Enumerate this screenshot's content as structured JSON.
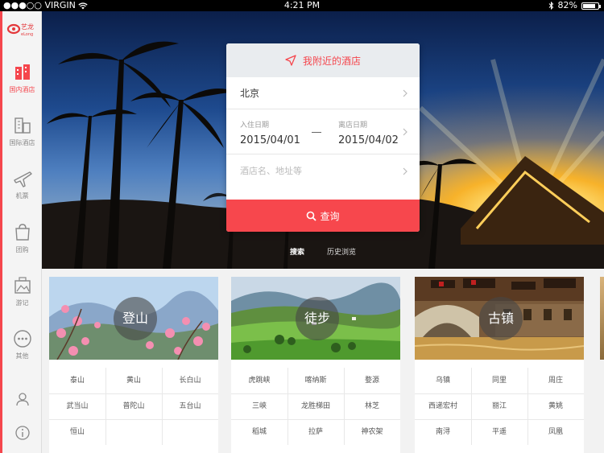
{
  "status_bar": {
    "carrier": "●●●○○ VIRGIN",
    "time": "4:21 PM",
    "battery": "82%",
    "battery_level": 0.82
  },
  "sidebar": {
    "logo_text": "艺龙",
    "logo_sub": "eLong",
    "items": [
      {
        "label": "国内酒店",
        "icon": "hotel-icon",
        "active": true
      },
      {
        "label": "国际酒店",
        "icon": "international-hotel-icon"
      },
      {
        "label": "机票",
        "icon": "airplane-icon"
      },
      {
        "label": "团购",
        "icon": "shopping-bag-icon"
      },
      {
        "label": "游记",
        "icon": "travel-notes-icon"
      },
      {
        "label": "其他",
        "icon": "more-icon"
      }
    ],
    "bottom_icons": [
      "user-icon",
      "info-icon"
    ]
  },
  "search": {
    "nearby_label": "我附近的酒店",
    "city": "北京",
    "checkin_label": "入住日期",
    "checkin_value": "2015/04/01",
    "checkout_label": "离店日期",
    "checkout_value": "2015/04/02",
    "keyword_placeholder": "酒店名、地址等",
    "search_button": "查询",
    "tabs": [
      "搜索",
      "历史浏览"
    ]
  },
  "categories": [
    {
      "title": "登山",
      "places": [
        "泰山",
        "黄山",
        "长白山",
        "武当山",
        "普陀山",
        "五台山",
        "恒山"
      ]
    },
    {
      "title": "徒步",
      "places": [
        "虎跳峡",
        "喀纳斯",
        "婺源",
        "三峡",
        "龙胜梯田",
        "林芝",
        "稻城",
        "拉萨",
        "神农架"
      ]
    },
    {
      "title": "古镇",
      "places": [
        "乌镇",
        "同里",
        "周庄",
        "西递宏村",
        "丽江",
        "黄姚",
        "南浔",
        "平遥",
        "凤凰"
      ]
    }
  ],
  "colors": {
    "accent": "#f5464d",
    "sidebar_bg": "#f4f4f4"
  }
}
